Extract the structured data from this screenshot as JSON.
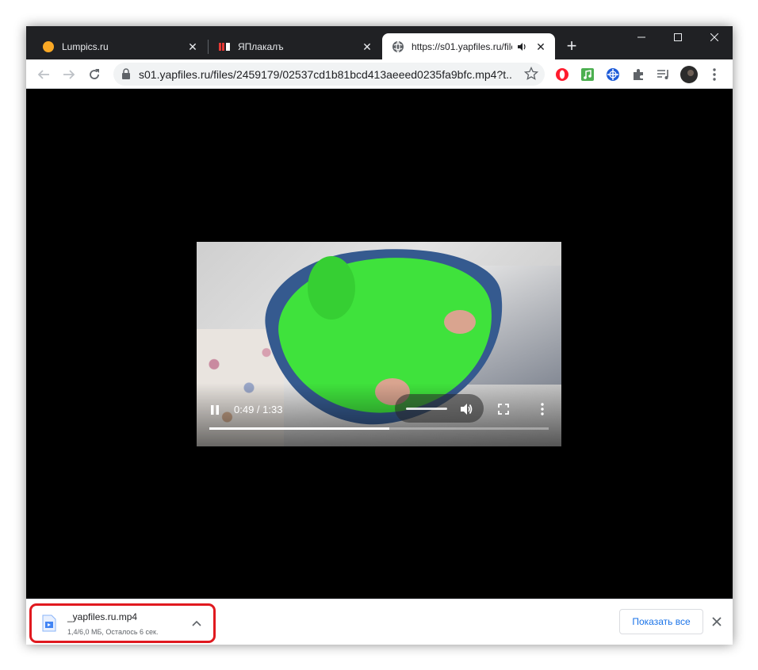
{
  "tabs": [
    {
      "title": "Lumpics.ru",
      "icon": "lumpics-favicon",
      "active": false
    },
    {
      "title": "ЯПлакалъ",
      "icon": "yaplakal-favicon",
      "active": false
    },
    {
      "title": "https://s01.yapfiles.ru/file",
      "icon": "globe-icon",
      "active": true,
      "audio": "speaker-icon"
    }
  ],
  "toolbar": {
    "url": "s01.yapfiles.ru/files/2459179/02537cd1b81bcd413aeeed0235fa9bfc.mp4?t...",
    "extensions": [
      "opera-extension-icon",
      "music-extension-icon",
      "vpn-extension-icon",
      "puzzle-extensions-icon",
      "media-control-icon",
      "profile-avatar"
    ]
  },
  "video": {
    "time": "0:49 / 1:33",
    "progress": 0.53,
    "volume": 1.0
  },
  "download": {
    "filename": "_yapfiles.ru.mp4",
    "status": "1,4/6,0 МБ, Осталось 6 сек.",
    "show_all": "Показать все"
  },
  "colors": {
    "tabstrip": "#202124",
    "highlight": "#e0191f",
    "link": "#1a73e8"
  }
}
